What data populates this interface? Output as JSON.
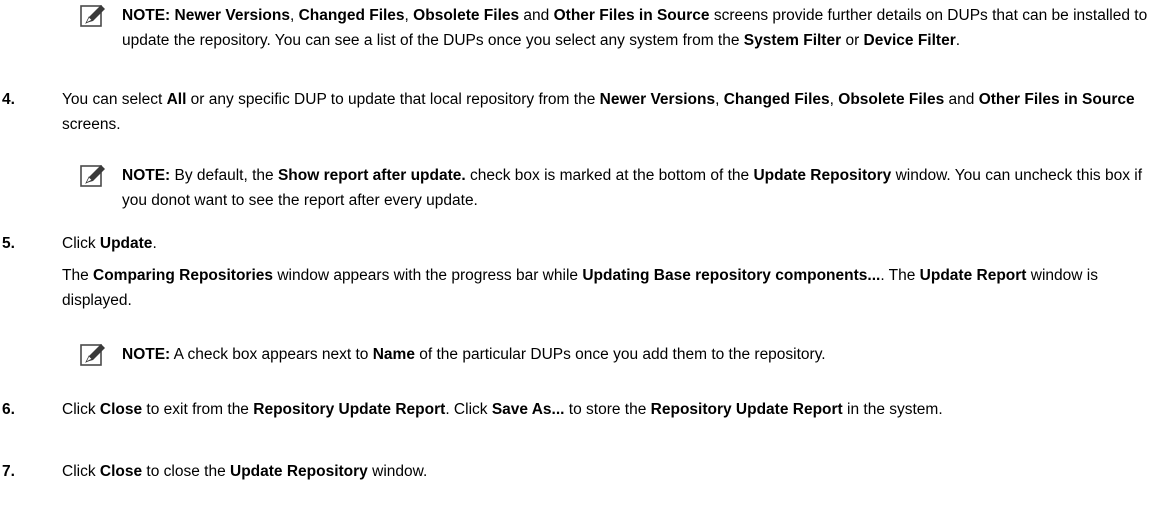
{
  "note1": {
    "parts": [
      "NOTE: ",
      "Newer Versions",
      ", ",
      "Changed Files",
      ", ",
      "Obsolete Files",
      " and ",
      "Other Files in Source",
      " screens provide further details on DUPs that can be installed to update the repository. You can see a list of the DUPs once you select any system from the ",
      "System Filter",
      " or ",
      "Device Filter",
      "."
    ]
  },
  "step4": {
    "num": "4.",
    "parts": [
      "You can select ",
      "All",
      " or any specific DUP to update that local repository from the ",
      "Newer Versions",
      ", ",
      "Changed Files",
      ", ",
      "Obsolete Files",
      " and ",
      "Other Files in Source",
      " screens."
    ]
  },
  "note2": {
    "parts": [
      "NOTE:",
      " By default, the ",
      "Show report after update.",
      " check box is marked at the bottom of the ",
      "Update Repository",
      " window. You can uncheck this box if you donot want to see the report after every update."
    ]
  },
  "step5": {
    "num": "5.",
    "parts": [
      "Click ",
      "Update",
      "."
    ],
    "para2": [
      "The ",
      "Comparing Repositories",
      " window appears with the progress bar while ",
      "Updating Base repository components...",
      ". The ",
      "Update Report",
      " window is displayed."
    ]
  },
  "note3": {
    "parts": [
      "NOTE:",
      " A check box appears next to ",
      "Name",
      " of the particular DUPs once you add them to the repository."
    ]
  },
  "step6": {
    "num": "6.",
    "parts": [
      "Click ",
      "Close",
      " to exit from the ",
      "Repository Update Report",
      ". Click ",
      "Save As...",
      " to store the ",
      "Repository Update Report",
      " in the system."
    ]
  },
  "step7": {
    "num": "7.",
    "parts": [
      "Click ",
      "Close",
      " to close the ",
      "Update Repository",
      " window."
    ]
  }
}
